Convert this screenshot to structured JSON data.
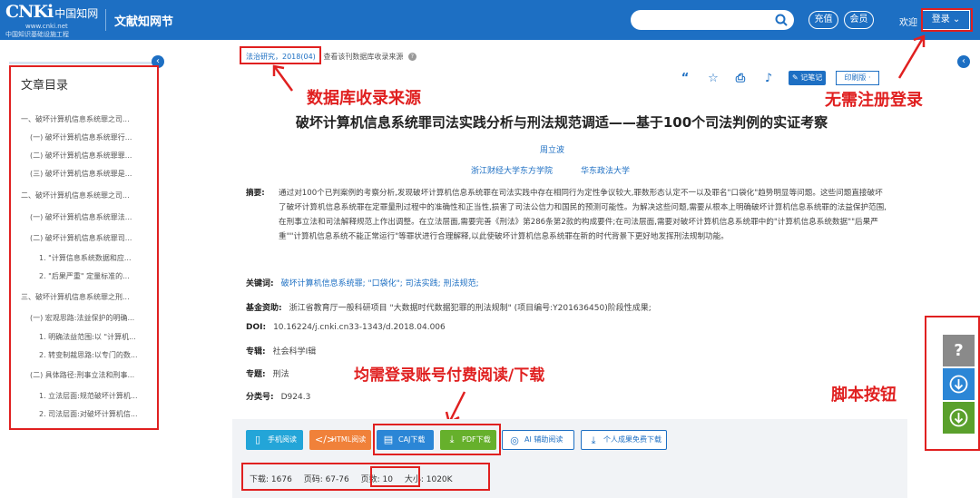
{
  "header": {
    "logo_text": "CNKi",
    "logo_cn": "中国知网",
    "logo_url": "www.cnki.net",
    "logo_sub": "中国知识基础设施工程",
    "section_title": "文献知网节",
    "search_placeholder": "",
    "recharge_label": "充值",
    "member_label": "会员",
    "welcome_label": "欢迎",
    "login_label": "登录 ⌄"
  },
  "annotations": {
    "source_label": "数据库收录来源",
    "no_register_label": "无需注册登录",
    "pay_label": "均需登录账号付费阅读/下载",
    "script_label": "脚本按钮"
  },
  "toc": {
    "title": "文章目录",
    "items": [
      "一、破坏计算机信息系统罪之司...",
      "(一) 破坏计算机信息系统罪行...",
      "(二) 破坏计算机信息系统罪罪...",
      "(三) 破坏计算机信息系统罪是...",
      "二、破坏计算机信息系统罪之司...",
      "(一) 破坏计算机信息系统罪法...",
      "(二) 破坏计算机信息系统罪司...",
      "1. \"计算信息系统数据和应...",
      "2. \"后果严重\" 定量标准的...",
      "三、破坏计算机信息系统罪之刑...",
      "(一) 宏观思路:法益保护的明确...",
      "1. 明确法益范围:以 \"计算机...",
      "2. 转变制裁思路:以专门的数...",
      "(二) 具体路径:刑事立法和刑事...",
      "1. 立法层面:规范破坏计算机...",
      "2. 司法层面:对破坏计算机信..."
    ]
  },
  "article": {
    "source": "法治研究，2018(04)",
    "source_link": "查看该刊数据库收录来源",
    "note_label": "记笔记",
    "print_label": "印刷版",
    "title": "破坏计算机信息系统罪司法实践分析与刑法规范调适——基于100个司法判例的实证考察",
    "author": "周立波",
    "affil_1": "浙江财经大学东方学院",
    "affil_2": "华东政法大学",
    "abstract_label": "摘要:",
    "abstract_text": "通过对100个已判案例的考察分析,发现破坏计算机信息系统罪在司法实践中存在相同行为定性争议较大,罪数形态认定不一以及罪名\"口袋化\"趋势明显等问题。这些问题直接破坏了破坏计算机信息系统罪在定罪量刑过程中的准确性和正当性,损害了司法公信力和国民的预测可能性。为解决这些问题,需要从根本上明确破坏计算机信息系统罪的法益保护范围,在刑事立法和司法解释规范上作出调整。在立法层面,需要完善《刑法》第286条第2款的构成要件;在司法层面,需要对破坏计算机信息系统罪中的\"计算机信息系统数据\"\"后果严重\"\"计算机信息系统不能正常运行\"等罪状进行合理解释,以此使破坏计算机信息系统罪在新的时代背景下更好地发挥刑法规制功能。",
    "keywords_label": "关键词:",
    "keywords": "破坏计算机信息系统罪;  \"口袋化\";  司法实践;  刑法规范;",
    "fund_label": "基金资助:",
    "fund": "浙江省教育厅一般科研项目 \"大数据时代数据犯罪的刑法规制\" (项目编号:Y201636450)阶段性成果;",
    "doi_label": "DOI:",
    "doi": "10.16224/j.cnki.cn33-1343/d.2018.04.006",
    "series_label": "专辑:",
    "series": "社会科学Ⅰ辑",
    "topic_label": "专题:",
    "topic": "刑法",
    "class_label": "分类号:",
    "class": "D924.3"
  },
  "actions": {
    "mobile_read": "手机阅读",
    "html_read": "HTML阅读",
    "caj_download": "CAJ下载",
    "pdf_download": "PDF下载",
    "ai_read": "AI 辅助阅读",
    "personal": "个人成果免费下载"
  },
  "stats": {
    "downloads": "下载: 1676",
    "pages": "页码: 67-76",
    "page_count": "页数: 10",
    "size": "大小: 1020K"
  },
  "colors": {
    "brand": "#1d6fc3",
    "annotation": "#e02020",
    "mobile": "#23a5d8",
    "html": "#f0813a",
    "caj": "#2b86d6",
    "pdf": "#66b02c",
    "fab_help": "#8a8a8a",
    "fab_blue": "#2b86d6",
    "fab_green": "#5aa02c"
  }
}
